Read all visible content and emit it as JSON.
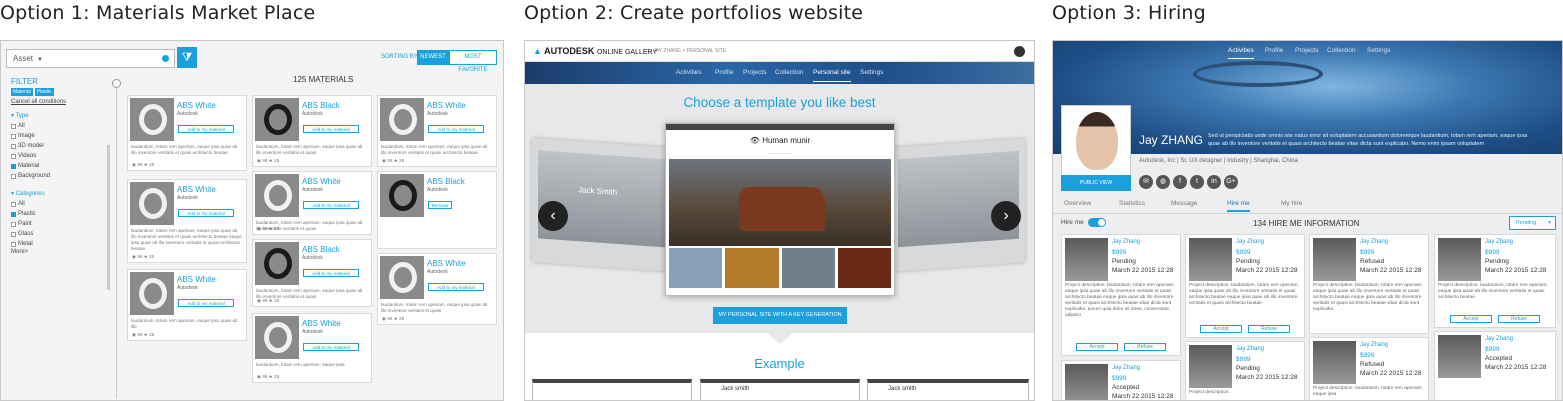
{
  "options": [
    {
      "title": "Option 1: Materials Market Place"
    },
    {
      "title": "Option 2: Create portfolios website"
    },
    {
      "title": "Option 3: Hiring"
    }
  ],
  "market": {
    "search": {
      "select": "Asset"
    },
    "sorting": {
      "label": "SORTING BY:",
      "newest": "NEWEST",
      "favorite": "MOST FAVORITE"
    },
    "filter": {
      "title": "FILTER",
      "tags": [
        "Material",
        "Plastic"
      ],
      "cancel": "Cancel all conditions",
      "type_title": "Type",
      "types": [
        {
          "label": "All",
          "checked": false
        },
        {
          "label": "Image",
          "checked": false
        },
        {
          "label": "3D model",
          "checked": false
        },
        {
          "label": "Videos",
          "checked": false
        },
        {
          "label": "Material",
          "checked": true
        },
        {
          "label": "Background",
          "checked": false
        }
      ],
      "cat_title": "Categories",
      "cats": [
        {
          "label": "All",
          "checked": false
        },
        {
          "label": "Plastic",
          "checked": true
        },
        {
          "label": "Paint",
          "checked": false
        },
        {
          "label": "Glass",
          "checked": false
        },
        {
          "label": "Metal",
          "checked": false
        }
      ],
      "more": "More>"
    },
    "count": "125 MATERIALS",
    "cards": [
      {
        "name": "ABS White",
        "maker": "Autodesk",
        "action": "Add to my material",
        "dark": false,
        "desc": "laudantium, totam rem aperiam, eaque ipsa quae ab illo inventore veritatis et quasi architecto beatae",
        "meta": "◉ 98  ★ 25"
      },
      {
        "name": "ABS White",
        "maker": "Autodesk",
        "action": "Add to my material",
        "dark": false,
        "desc": "laudantium, totam rem aperiam, eaque ipsa quae ab illo inventore veritatis et quasi architecto beatae eaque ipsa quae ab illo inventore veritatis et quasi architecto beatae",
        "meta": "◉ 98  ★ 25"
      },
      {
        "name": "ABS White",
        "maker": "Autodesk",
        "action": "Add to my material",
        "dark": false,
        "desc": "laudantium, totam rem aperiam, eaque ipsa quae ab illo",
        "meta": "◉ 98  ★ 25"
      },
      {
        "name": "ABS Black",
        "maker": "Autodesk",
        "action": "Add to my material",
        "dark": true,
        "desc": "laudantium, totam rem aperiam, eaque ipsa quae ab illo inventore veritatis et quasi",
        "meta": "◉ 98  ★ 25"
      },
      {
        "name": "ABS White",
        "maker": "Autodesk",
        "action": "Add to my material",
        "dark": false,
        "desc": "laudantium, totam rem aperiam, eaque ipsa quae ab illo inventore veritatis et quasi",
        "meta": "◉ 98  ★ 25"
      },
      {
        "name": "ABS Black",
        "maker": "Autodesk",
        "action": "Add to my material",
        "dark": true,
        "desc": "laudantium, totam rem aperiam, eaque ipsa quae ab illo inventore veritatis et quasi",
        "meta": "◉ 98  ★ 25"
      },
      {
        "name": "ABS White",
        "maker": "Autodesk",
        "action": "Add to my material",
        "dark": false,
        "desc": "laudantium, totam rem aperiam, eaque ipsa",
        "meta": "◉ 98  ★ 25"
      },
      {
        "name": "ABS White",
        "maker": "Autodesk",
        "action": "Add to my material",
        "dark": false,
        "desc": "laudantium, totam rem aperiam, eaque ipsa quae ab illo inventore veritatis et quasi architecto beatae",
        "meta": "◉ 98  ★ 25"
      },
      {
        "name": "ABS Black",
        "maker": "Autodesk",
        "action": "Remove",
        "dark": true,
        "desc": "",
        "meta": ""
      },
      {
        "name": "ABS White",
        "maker": "Autodesk",
        "action": "Add to my material",
        "dark": false,
        "desc": "laudantium, totam rem aperiam, eaque ipsa quae ab illo inventore veritatis et quasi",
        "meta": "◉ 98  ★ 25"
      }
    ]
  },
  "gallery": {
    "logo": "AUTODESK",
    "gallery": "ONLINE GALLERY",
    "crumb": "> JAY ZHANG > PERSONAL SITE",
    "nav": [
      "Activities",
      "Profile",
      "Projects",
      "Collection",
      "Personal site",
      "Settings"
    ],
    "heading": "Choose a template you like best",
    "left_name": "Jack Smith",
    "center_name": "Human munir",
    "button": "MY PERSONAL SITE WITH A KEY GENERATION",
    "example": "Example",
    "example_cards": [
      "",
      "Jack smith",
      "Jack smith"
    ]
  },
  "hiring": {
    "nav": [
      "Activities",
      "Profile",
      "Projects",
      "Collection",
      "Settings"
    ],
    "name": "Jay ZHANG",
    "bio": "Sed ut perspiciatis unde omnis iste natus error sit voluptatem accusantium doloremque laudantium, totam rem aperiam, eaque ipsa quae ab illo inventore veritatis et quasi architecto beatae vitae dicta sunt explicabo. Nemo enim ipsam voluptatem",
    "sub": "Autodesk, Inc | Sr. UX designer | Industry | Shanghai, China",
    "public": "PUBLIC VIEW",
    "social": [
      "✉",
      "◍",
      "f",
      "t",
      "in",
      "G+"
    ],
    "tabs": [
      "Overview",
      "Statistics",
      "Message",
      "Hire me",
      "My hire"
    ],
    "hire_label": "Hire me",
    "info": "134 HIRE ME INFORMATION",
    "pending": "Pending",
    "cards": [
      {
        "name": "Jay Zhang",
        "price": "$999",
        "status": "Pending",
        "date": "March 22 2015 12:28",
        "desc": "Project description: laudantium, totam rem aperiam, eaque ipsa quae ab illo inventore veritatis et quasi architecto beatae eaque ipsa quae ab illo inventore veritatis et quasi architecto beatae vitae dicta sunt explicabo. Ipsum quia dolor sit amet, consectetur, adipisci",
        "accept": "Accept",
        "refuse": "Refuse"
      },
      {
        "name": "Jay Zhang",
        "price": "$999",
        "status": "Pending",
        "date": "March 22 2015 12:28",
        "desc": "Project description: laudantium, totam rem aperiam, eaque ipsa quae ab illo inventore veritatis et quasi architecto beatae eaque ipsa quae ab illo inventore veritatis et quasi architecto beatae",
        "accept": "Accept",
        "refuse": "Refuse"
      },
      {
        "name": "Jay Zhang",
        "price": "$999",
        "status": "Refused",
        "date": "March 22 2015 12:28",
        "desc": "Project description: laudantium, totam rem aperiam, eaque ipsa quae ab illo inventore veritatis et quasi architecto beatae eaque ipsa quae ab illo inventore veritatis et quasi architecto beatae vitae dicta sunt explicabo.",
        "accept": "",
        "refuse": ""
      },
      {
        "name": "Jay Zhang",
        "price": "$999",
        "status": "Pending",
        "date": "March 22 2015 12:28",
        "desc": "Project description: laudantium, totam rem aperiam, eaque ipsa quae ab illo inventore veritatis et quasi architecto beatae.",
        "accept": "Accept",
        "refuse": "Refuse"
      },
      {
        "name": "Jay Zhang",
        "price": "$999",
        "status": "Accepted",
        "date": "March 22 2015 12:28",
        "desc": "",
        "accept": "",
        "refuse": ""
      },
      {
        "name": "Jay Zhang",
        "price": "$999",
        "status": "Pending",
        "date": "March 22 2015 12:28",
        "desc": "Project description:",
        "accept": "",
        "refuse": ""
      },
      {
        "name": "Jay Zhang",
        "price": "$999",
        "status": "Refused",
        "date": "March 22 2015 12:28",
        "desc": "Project description: laudantium, totam rem aperiam, eaque ipsa",
        "accept": "",
        "refuse": ""
      },
      {
        "name": "Jay Zhang",
        "price": "$999",
        "status": "Accepted",
        "date": "March 22 2015 12:28",
        "desc": "",
        "accept": "",
        "refuse": ""
      }
    ]
  }
}
